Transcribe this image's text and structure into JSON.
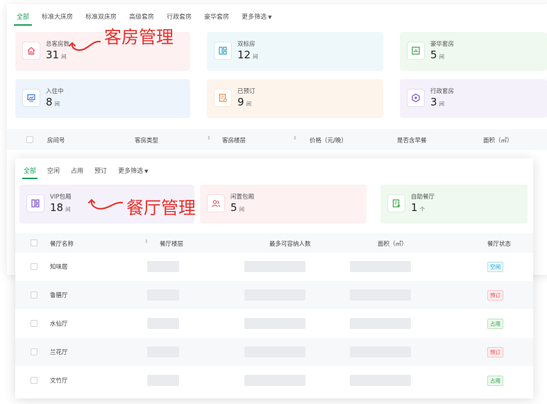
{
  "rooms": {
    "tabs": [
      "全部",
      "标准大床房",
      "标准双床房",
      "高级套房",
      "行政套房",
      "豪华套房",
      "更多筛选"
    ],
    "cards": [
      {
        "label": "总客房数",
        "value": "31",
        "unit": "间",
        "icon": "home-icon",
        "color": "#e8516b",
        "bg": "#fdf1f2"
      },
      {
        "label": "双标房",
        "value": "12",
        "unit": "间",
        "icon": "layout-icon",
        "color": "#2aa3c9",
        "bg": "#eef8fb"
      },
      {
        "label": "豪华套房",
        "value": "5",
        "unit": "间",
        "icon": "chart-icon",
        "color": "#3a9f48",
        "bg": "#eff9ef"
      },
      {
        "label": "入住中",
        "value": "8",
        "unit": "间",
        "icon": "monitor-icon",
        "color": "#2e76d0",
        "bg": "#edf4fc"
      },
      {
        "label": "已预订",
        "value": "9",
        "unit": "间",
        "icon": "booking-icon",
        "color": "#e58a3a",
        "bg": "#fdf4ec"
      },
      {
        "label": "行政套房",
        "value": "3",
        "unit": "间",
        "icon": "hexagon-icon",
        "color": "#7c4dc4",
        "bg": "#f5f1fb"
      }
    ],
    "table_headers": [
      "房间号",
      "客房类型",
      "客房楼层",
      "价格（元/晚）",
      "是否含早餐",
      "面积（㎡）"
    ],
    "annotation": "客房管理"
  },
  "dining": {
    "tabs": [
      "全部",
      "空闲",
      "占用",
      "预订",
      "更多筛选"
    ],
    "cards": [
      {
        "label": "VIP包厢",
        "value": "18",
        "unit": "间",
        "icon": "layout-icon",
        "color": "#7c4dc4",
        "bg": "#f5f1fb"
      },
      {
        "label": "闲置包厢",
        "value": "5",
        "unit": "间",
        "icon": "people-icon",
        "color": "#e8516b",
        "bg": "#fdf1f2"
      },
      {
        "label": "自助餐厅",
        "value": "1",
        "unit": "个",
        "icon": "doc-add-icon",
        "color": "#3a9f48",
        "bg": "#eff9ef"
      }
    ],
    "table_headers": [
      "餐厅名称",
      "餐厅楼层",
      "最多可容纳人数",
      "面积（㎡）",
      "餐厅状态"
    ],
    "rows": [
      {
        "name": "知味居",
        "status": "空闲"
      },
      {
        "name": "鲁膳厅",
        "status": "预订"
      },
      {
        "name": "水仙厅",
        "status": "占用"
      },
      {
        "name": "兰花厅",
        "status": "预订"
      },
      {
        "name": "文竹厅",
        "status": "占用"
      }
    ],
    "status_colors": {
      "空闲": {
        "fg": "#1aa3c9",
        "bg": "#eaf7fb",
        "border": "#b5e2f0"
      },
      "预订": {
        "fg": "#e5454e",
        "bg": "#fdeeef",
        "border": "#f7c3c6"
      },
      "占用": {
        "fg": "#2d9e3c",
        "bg": "#ecf8ed",
        "border": "#bde5c2"
      }
    },
    "annotation": "餐厅管理"
  },
  "accent": "#18a058"
}
